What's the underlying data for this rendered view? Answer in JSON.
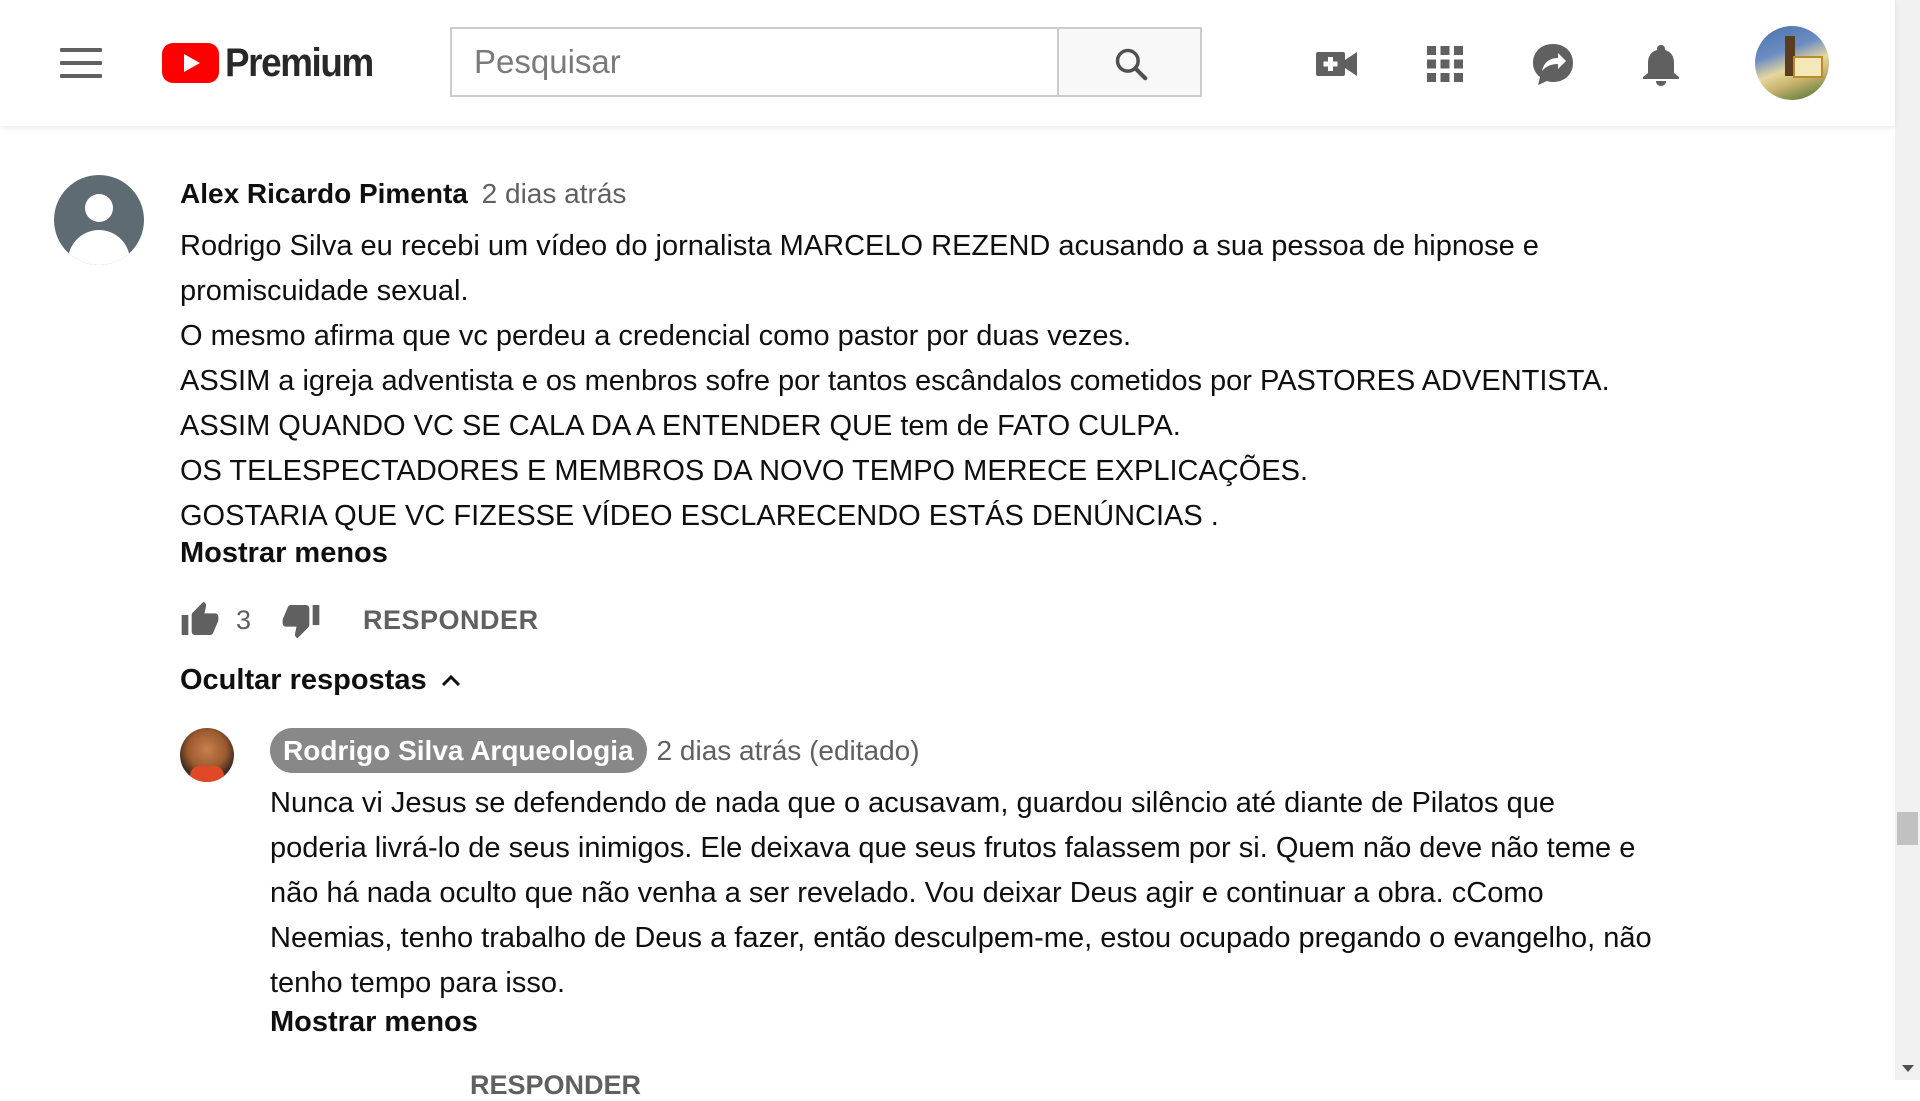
{
  "header": {
    "logo_text": "Premium",
    "search_placeholder": "Pesquisar",
    "brand_color": "#ff0000",
    "icons": [
      "menu-icon",
      "search-icon",
      "create-video-icon",
      "apps-grid-icon",
      "messages-icon",
      "notifications-bell-icon"
    ]
  },
  "comment": {
    "author": "Alex Ricardo Pimenta",
    "time": "2 dias atrás",
    "lines": [
      "Rodrigo  Silva eu recebi  um vídeo  do jornalista MARCELO  REZEND  acusando a sua pessoa  de hipnose  e",
      "promiscuidade sexual.",
      "O mesmo afirma que vc perdeu a credencial como pastor por duas vezes.",
      "ASSIM  a igreja  adventista e os menbros sofre por tantos escândalos cometidos por PASTORES ADVENTISTA.",
      "ASSIM QUANDO VC SE CALA DA A ENTENDER  QUE tem de FATO CULPA.",
      "OS TELESPECTADORES  E MEMBROS DA NOVO TEMPO MERECE  EXPLICAÇÕES.",
      "GOSTARIA QUE VC FIZESSE  VÍDEO  ESCLARECENDO  ESTÁS  DENÚNCIAS ."
    ],
    "show_less": "Mostrar menos",
    "like_count": "3",
    "reply_label": "RESPONDER",
    "hide_replies": "Ocultar respostas"
  },
  "reply": {
    "author": "Rodrigo Silva Arqueologia",
    "time": "2 dias atrás (editado)",
    "lines": [
      "Nunca vi Jesus se defendendo de nada que o acusavam, guardou silêncio até diante de Pilatos que",
      "poderia livrá-lo de seus inimigos. Ele deixava que seus frutos falassem por si. Quem não deve não teme e",
      "não há nada oculto que não venha a ser revelado. Vou deixar Deus agir e continuar a obra. cComo",
      "Neemias, tenho trabalho de Deus a fazer, então desculpem-me, estou ocupado pregando o evangelho, não",
      "tenho tempo para isso."
    ],
    "show_less": "Mostrar menos",
    "cut_off_row": "RESPONDER"
  }
}
